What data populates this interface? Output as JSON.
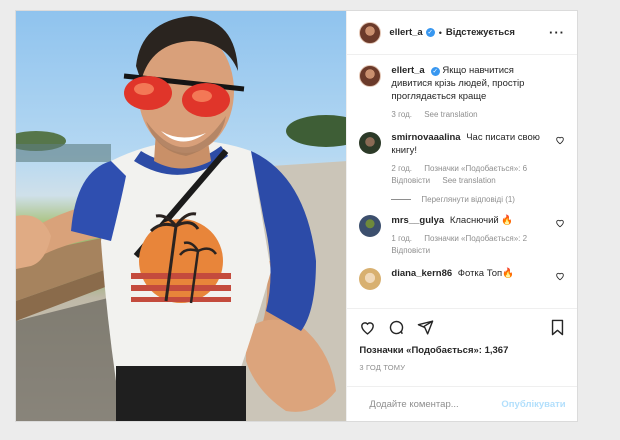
{
  "post": {
    "author": "ellert_a",
    "follow_status": "Відстежується",
    "caption": "Якщо навчитися дивитися крізь людей, простір проглядається краще",
    "caption_time": "3 год.",
    "see_translation": "See translation"
  },
  "comments": [
    {
      "user": "smirnovaaalina",
      "text": "Час писати свою книгу!",
      "time": "2 год.",
      "likes": "Позначки «Подобається»: 6",
      "reply": "Відповісти",
      "translate": "See translation"
    },
    {
      "user": "mrs__gulya",
      "text": "Класнючий 🔥",
      "time": "1 год.",
      "likes": "Позначки «Подобається»: 2",
      "reply": "Відповісти"
    },
    {
      "user": "diana_kern86",
      "text": "Фотка Топ🔥",
      "time": "",
      "likes": "",
      "reply": ""
    }
  ],
  "view_replies": "Переглянути відповіді (1)",
  "likes_total": "Позначки «Подобається»: 1,367",
  "time_ago": "3 ГОД ТОМУ",
  "add_comment_placeholder": "Додайте коментар...",
  "publish_label": "Опублікувати",
  "icons": [
    "heart-icon",
    "comment-icon",
    "share-icon",
    "bookmark-icon",
    "emoji-icon",
    "more-icon",
    "verified-icon"
  ]
}
